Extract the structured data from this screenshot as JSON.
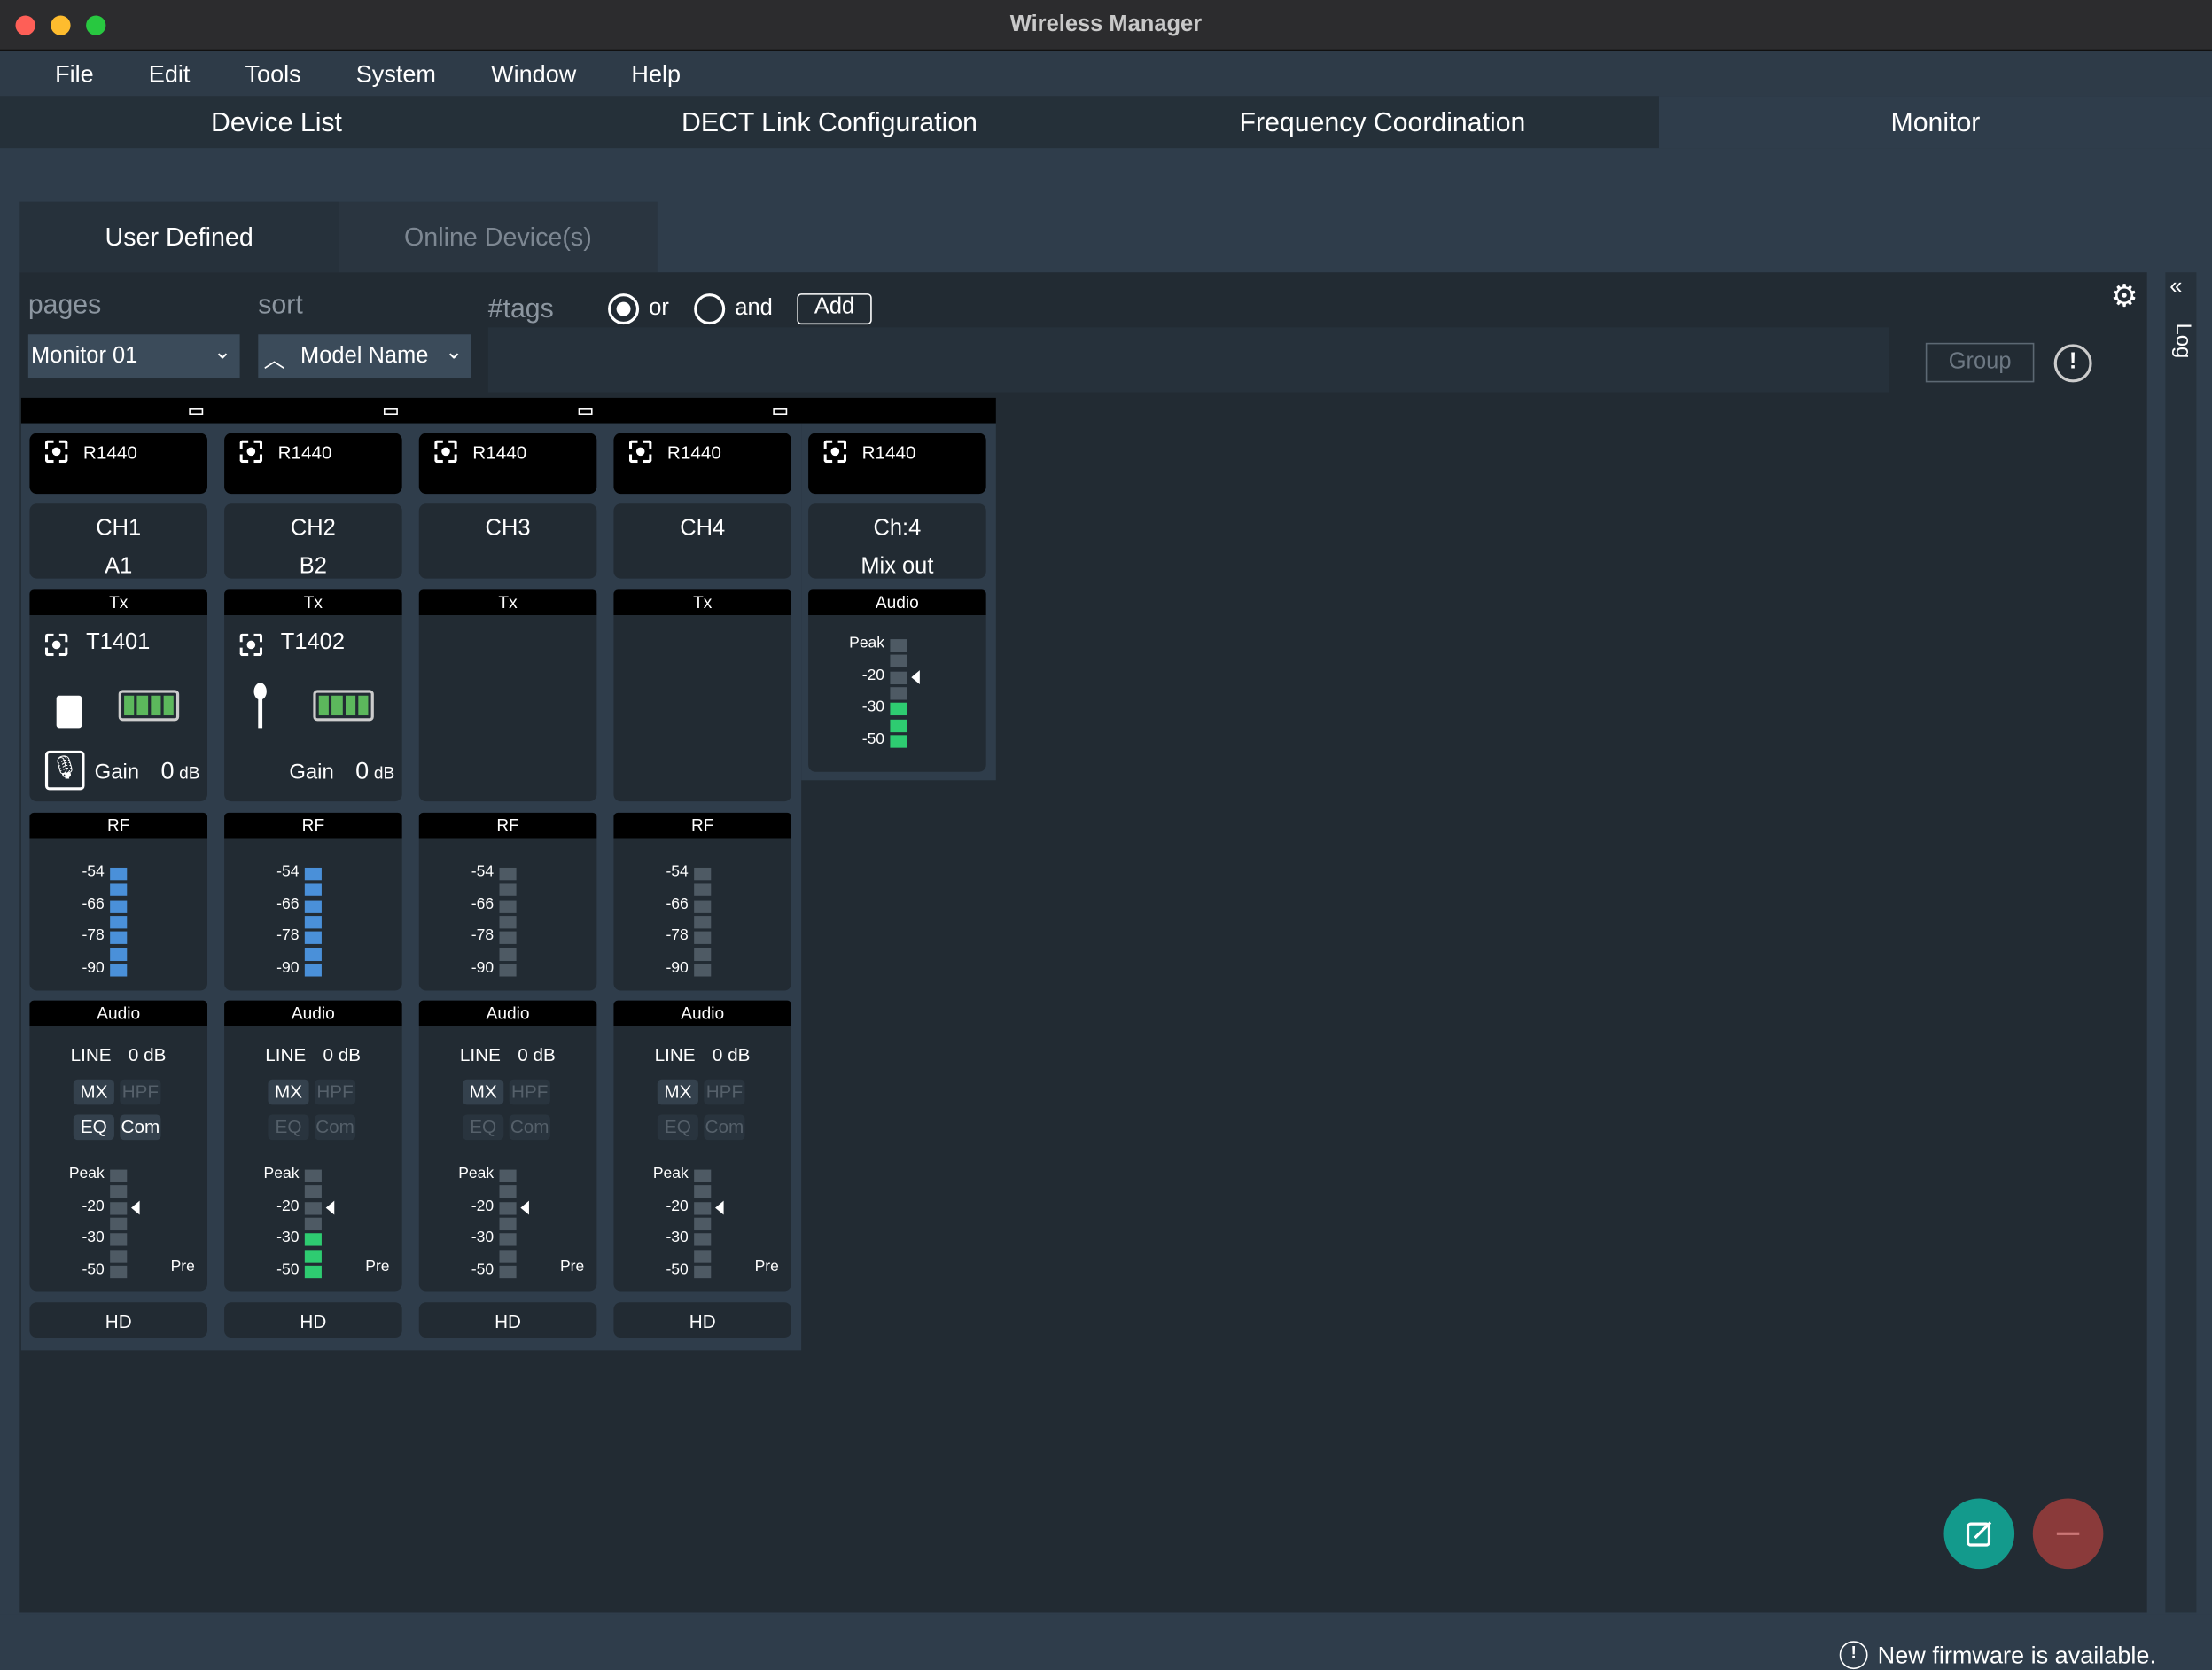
{
  "window": {
    "title": "Wireless Manager"
  },
  "menu": [
    "File",
    "Edit",
    "Tools",
    "System",
    "Window",
    "Help"
  ],
  "tabs": [
    {
      "label": "Device List"
    },
    {
      "label": "DECT Link Configuration"
    },
    {
      "label": "Frequency Coordination"
    },
    {
      "label": "Monitor",
      "active": true
    }
  ],
  "subtabs": [
    {
      "label": "User Defined",
      "active": true
    },
    {
      "label": "Online Device(s)"
    }
  ],
  "filters": {
    "pages_label": "pages",
    "pages_value": "Monitor 01",
    "sort_label": "sort",
    "sort_value": "Model Name",
    "tags_label": "#tags",
    "or_label": "or",
    "and_label": "and",
    "or_selected": true,
    "add_label": "Add",
    "group_label": "Group"
  },
  "log_label": "Log",
  "rf_scale": [
    "-54",
    "-66",
    "-78",
    "-90"
  ],
  "audio_scale": [
    "Peak",
    "-20",
    "-30",
    "-50"
  ],
  "columns": [
    {
      "receiver": "R1440",
      "ch": "CH1",
      "name": "A1",
      "tx_header": "Tx",
      "tx": "T1401",
      "tx_type": "bodypack",
      "battery": 1.0,
      "muted": true,
      "gain_label": "Gain",
      "gain": "0",
      "gain_unit": "dB",
      "rf_header": "RF",
      "rf_lit": 7,
      "audio_header": "Audio",
      "input": "LINE",
      "input_gain": "0 dB",
      "mx": "MX",
      "hpf": "HPF",
      "eq": "EQ",
      "com": "Com",
      "mx_on": true,
      "hpf_on": false,
      "eq_on": true,
      "com_on": true,
      "audio_lit": 0,
      "pre": "Pre",
      "hd": "HD"
    },
    {
      "receiver": "R1440",
      "ch": "CH2",
      "name": "B2",
      "tx_header": "Tx",
      "tx": "T1402",
      "tx_type": "handheld",
      "battery": 1.0,
      "muted": false,
      "gain_label": "Gain",
      "gain": "0",
      "gain_unit": "dB",
      "rf_header": "RF",
      "rf_lit": 7,
      "audio_header": "Audio",
      "input": "LINE",
      "input_gain": "0 dB",
      "mx": "MX",
      "hpf": "HPF",
      "eq": "EQ",
      "com": "Com",
      "mx_on": true,
      "hpf_on": false,
      "eq_on": false,
      "com_on": false,
      "audio_lit": 3,
      "pre": "Pre",
      "hd": "HD"
    },
    {
      "receiver": "R1440",
      "ch": "CH3",
      "name": "",
      "tx_header": "Tx",
      "rf_header": "RF",
      "rf_lit": 0,
      "audio_header": "Audio",
      "input": "LINE",
      "input_gain": "0 dB",
      "mx": "MX",
      "hpf": "HPF",
      "eq": "EQ",
      "com": "Com",
      "mx_on": true,
      "hpf_on": false,
      "eq_on": false,
      "com_on": false,
      "audio_lit": 0,
      "pre": "Pre",
      "hd": "HD"
    },
    {
      "receiver": "R1440",
      "ch": "CH4",
      "name": "",
      "tx_header": "Tx",
      "rf_header": "RF",
      "rf_lit": 0,
      "audio_header": "Audio",
      "input": "LINE",
      "input_gain": "0 dB",
      "mx": "MX",
      "hpf": "HPF",
      "eq": "EQ",
      "com": "Com",
      "mx_on": true,
      "hpf_on": false,
      "eq_on": false,
      "com_on": false,
      "audio_lit": 0,
      "pre": "Pre",
      "hd": "HD"
    }
  ],
  "mix": {
    "receiver": "R1440",
    "ch": "Ch:4",
    "name": "Mix out",
    "audio_header": "Audio",
    "audio_lit": 3
  },
  "colors": {
    "rf": "#4a90d9",
    "audio": "#2ecc71",
    "off": "#4e5a64",
    "fab_edit": "#139a8c",
    "fab_remove": "#8a3a3a"
  },
  "status": {
    "message": "New firmware is available."
  }
}
